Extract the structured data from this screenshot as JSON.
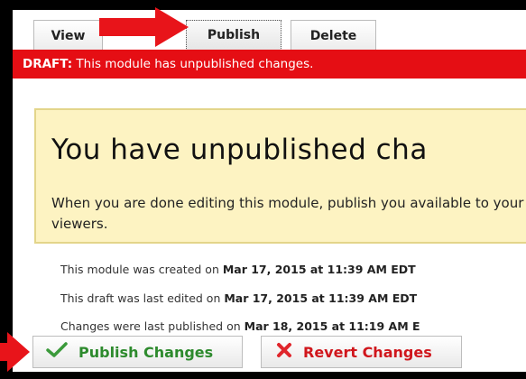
{
  "tabs": [
    {
      "label": "View"
    },
    {
      "label": "Publish"
    },
    {
      "label": "Delete"
    }
  ],
  "draft_bar": {
    "prefix": "DRAFT:",
    "message": " This module has unpublished changes."
  },
  "notice": {
    "heading": "You have unpublished cha",
    "body": "When you are done editing this module, publish you available to your viewers."
  },
  "meta": {
    "created_prefix": "This module was created on ",
    "created_value": "Mar 17, 2015 at 11:39 AM EDT",
    "edited_prefix": "This draft was last edited on ",
    "edited_value": "Mar 17, 2015 at 11:39 AM EDT",
    "published_prefix": "Changes were last published on ",
    "published_value": "Mar 18, 2015 at 11:19 AM E"
  },
  "buttons": {
    "publish": "Publish Changes",
    "revert": "Revert Changes"
  },
  "icons": {
    "publish": "checkmark-icon",
    "revert": "x-icon"
  },
  "colors": {
    "draft_bar": "#e50e14",
    "notice_bg": "#fdf3c2",
    "publish_text": "#2d8a2d",
    "revert_text": "#d0161c",
    "annotation_arrow": "#e8141a"
  }
}
